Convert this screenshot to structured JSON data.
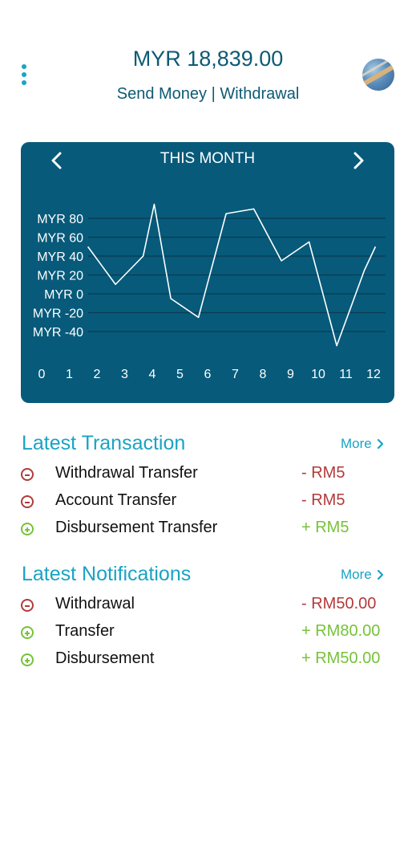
{
  "header": {
    "balance": "MYR 18,839.00",
    "send_money": "Send Money",
    "separator": " | ",
    "withdrawal": "Withdrawal"
  },
  "card": {
    "period_label": "THIS MONTH",
    "prev_icon": "chevron-left-icon",
    "next_icon": "chevron-right-icon"
  },
  "chart_data": {
    "type": "line",
    "x": [
      2,
      3,
      4,
      4.4,
      5,
      6,
      7,
      8,
      9,
      10,
      11,
      12,
      12.4
    ],
    "values": [
      50,
      10,
      40,
      95,
      -5,
      -25,
      85,
      90,
      35,
      55,
      -55,
      25,
      50
    ],
    "x_ticks": [
      "0",
      "1",
      "2",
      "3",
      "4",
      "5",
      "6",
      "7",
      "8",
      "9",
      "10",
      "11",
      "12"
    ],
    "y_ticks": [
      "MYR 80",
      "MYR 60",
      "MYR 40",
      "MYR 20",
      "MYR 0",
      "MYR -20",
      "MYR -40"
    ],
    "ylim": [
      -40,
      80
    ],
    "grid": true,
    "colors": {
      "line": "#ffffff",
      "grid": "#0a3b50",
      "background": "#075a7a"
    }
  },
  "transactions": {
    "title": "Latest Transaction",
    "more": "More",
    "items": [
      {
        "type": "minus",
        "label": "Withdrawal Transfer",
        "amount": "- RM5"
      },
      {
        "type": "minus",
        "label": "Account Transfer",
        "amount": "- RM5"
      },
      {
        "type": "plus",
        "label": "Disbursement Transfer",
        "amount": "+ RM5"
      }
    ]
  },
  "notifications": {
    "title": "Latest Notifications",
    "more": "More",
    "items": [
      {
        "type": "minus",
        "label": "Withdrawal",
        "amount": "- RM50.00"
      },
      {
        "type": "plus",
        "label": "Transfer",
        "amount": "+ RM80.00"
      },
      {
        "type": "plus",
        "label": "Disbursement",
        "amount": "+ RM50.00"
      }
    ]
  },
  "colors": {
    "accent": "#1aa3c4",
    "primary": "#0d5a74",
    "negative": "#b33a3a",
    "positive": "#77c23a"
  }
}
